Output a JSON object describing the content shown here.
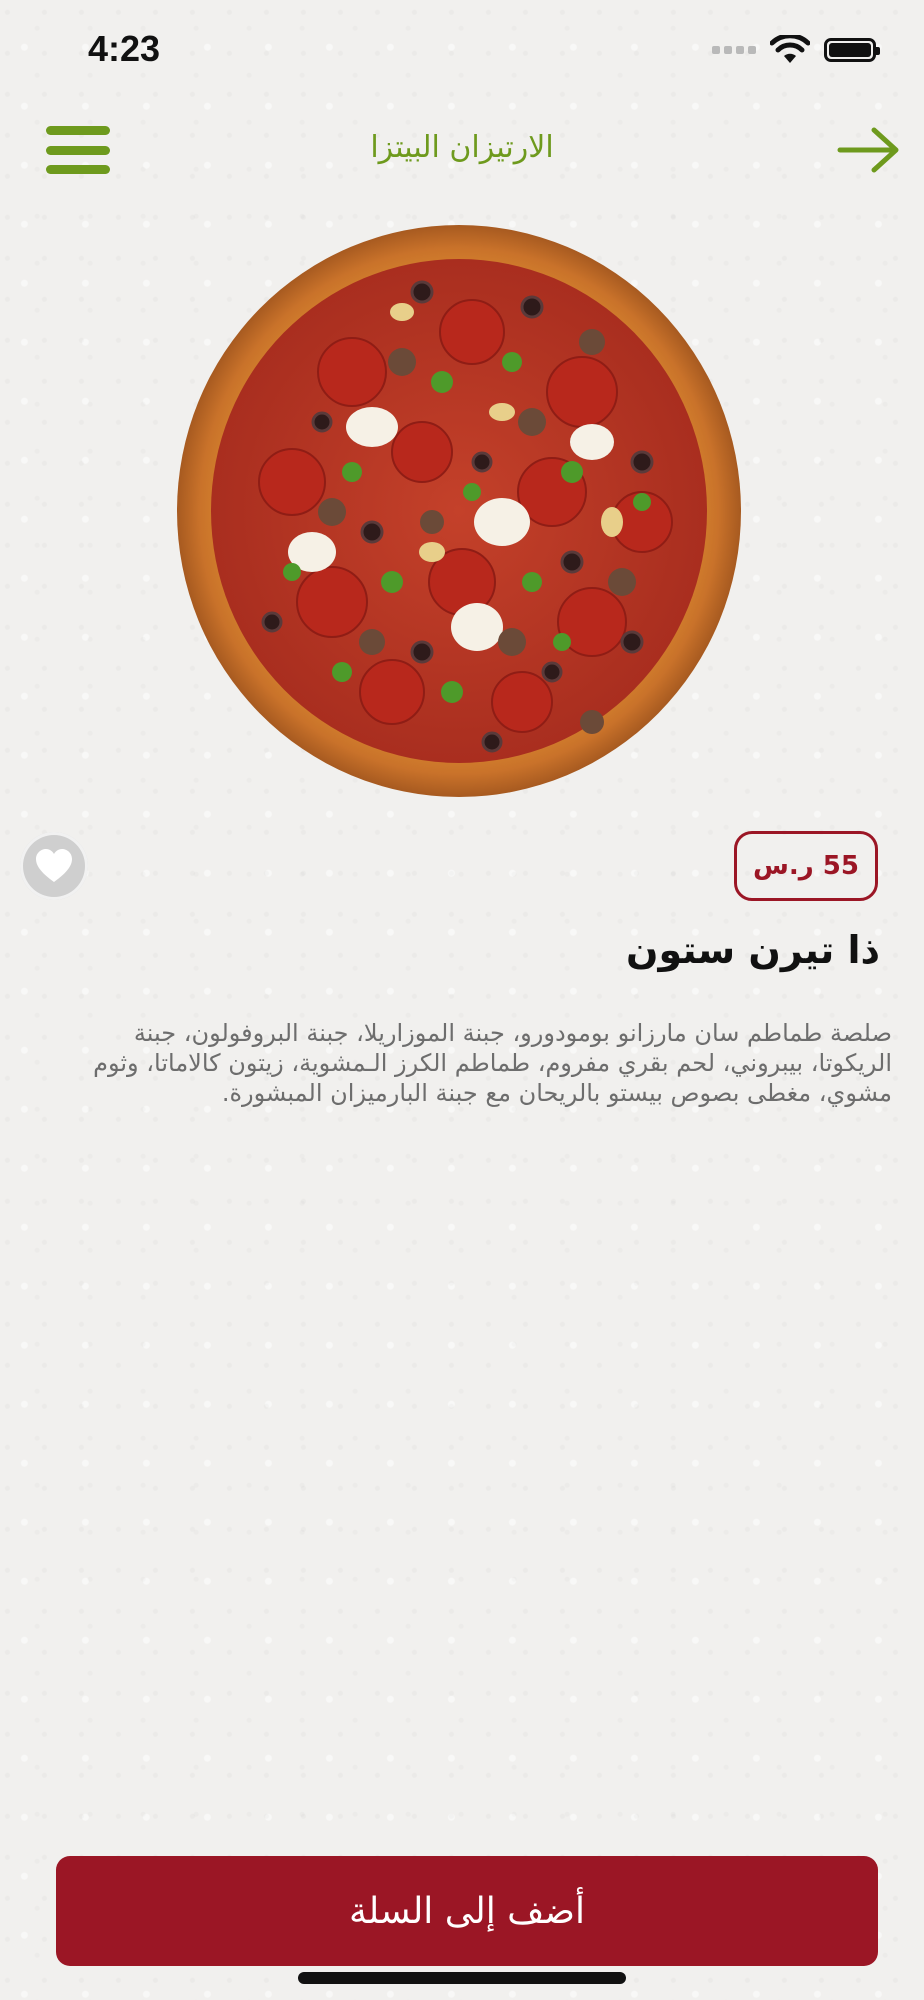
{
  "status_bar": {
    "time": "4:23"
  },
  "header": {
    "title": "الارتيزان البيتزا",
    "menu_icon": "hamburger-menu-icon",
    "back_icon": "arrow-right-icon"
  },
  "product": {
    "image_icon": "pizza-image",
    "price": "55 ر.س",
    "name": "ذا تيرن ستون",
    "description": "صلصة طماطم سان مارزانو بومودورو، جبنة الموزاريلا، جبنة البروفولون، جبنة الريكوتا، بيبروني، لحم بقري مفروم، طماطم الكرز الـمشوية، زيتون كالاماتا، وثوم مشوي، مغطى بصوص بيستو بالريحان مع جبنة البارميزان المبشورة.",
    "favorite_icon": "heart-icon"
  },
  "cart": {
    "add_label": "أضف إلى السلة"
  },
  "colors": {
    "accent_green": "#6e9a1d",
    "brand_red": "#9b1625"
  }
}
